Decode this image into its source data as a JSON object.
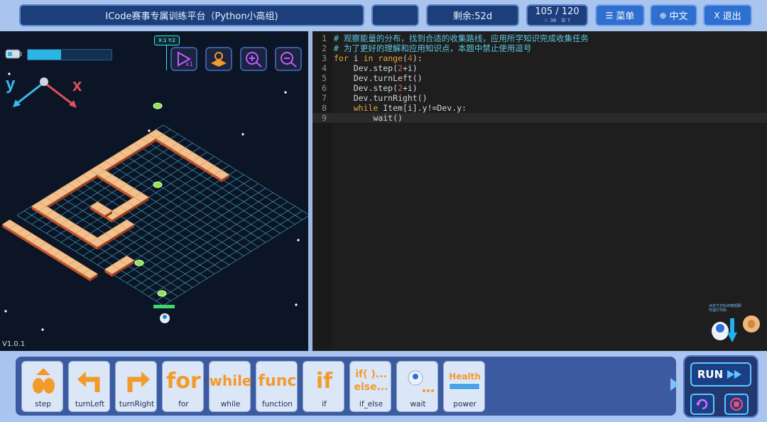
{
  "header": {
    "title": "ICode赛事专属训练平台（Python小高组)",
    "time_left": "剩余:52d",
    "level": "105 / 120",
    "level_stat_a": "36",
    "level_stat_b": "7",
    "menu_label": "菜单",
    "lang_label": "中文",
    "exit_label": "退出",
    "menu_icon": "☰",
    "lang_icon": "⊕",
    "exit_icon": "X"
  },
  "game": {
    "version": "V1.0.1",
    "coord_tag": "X:1 Y:2",
    "axis_y": "y",
    "axis_x": "x",
    "energy_level": 0.4
  },
  "code": {
    "lines": [
      "# 观察能量的分布，找到合适的收集路线，应用所学知识完成收集任务",
      "# 为了更好的理解和应用知识点，本题中禁止使用逗号",
      "for i in range(4):",
      "    Dev.step(2+i)",
      "    Dev.turnLeft()",
      "    Dev.step(2+i)",
      "    Dev.turnRight()",
      "    while Item[i].y!=Dev.y:",
      "        wait()"
    ]
  },
  "helper": {
    "text": "点击下方RUN按钮即可运行代码"
  },
  "blocks": [
    {
      "label": "step",
      "icon": "step-icon"
    },
    {
      "label": "turnLeft",
      "icon": "turn-left-icon"
    },
    {
      "label": "turnRight",
      "icon": "turn-right-icon"
    },
    {
      "label": "for",
      "icon": "for-icon",
      "word": "for"
    },
    {
      "label": "while",
      "icon": "while-icon",
      "word": "while"
    },
    {
      "label": "function",
      "icon": "function-icon",
      "word": "func"
    },
    {
      "label": "if",
      "icon": "if-icon",
      "word": "if"
    },
    {
      "label": "if_else",
      "icon": "if-else-icon",
      "word": "if( )...",
      "word2": "else..."
    },
    {
      "label": "wait",
      "icon": "wait-icon"
    },
    {
      "label": "power",
      "icon": "power-icon",
      "word": "Health"
    }
  ],
  "run": {
    "label": "RUN"
  },
  "colors": {
    "accent": "#2e6fd0",
    "code_bg": "#1e1e1e",
    "game_bg": "#0c1525",
    "block_orange": "#f39b2a"
  }
}
